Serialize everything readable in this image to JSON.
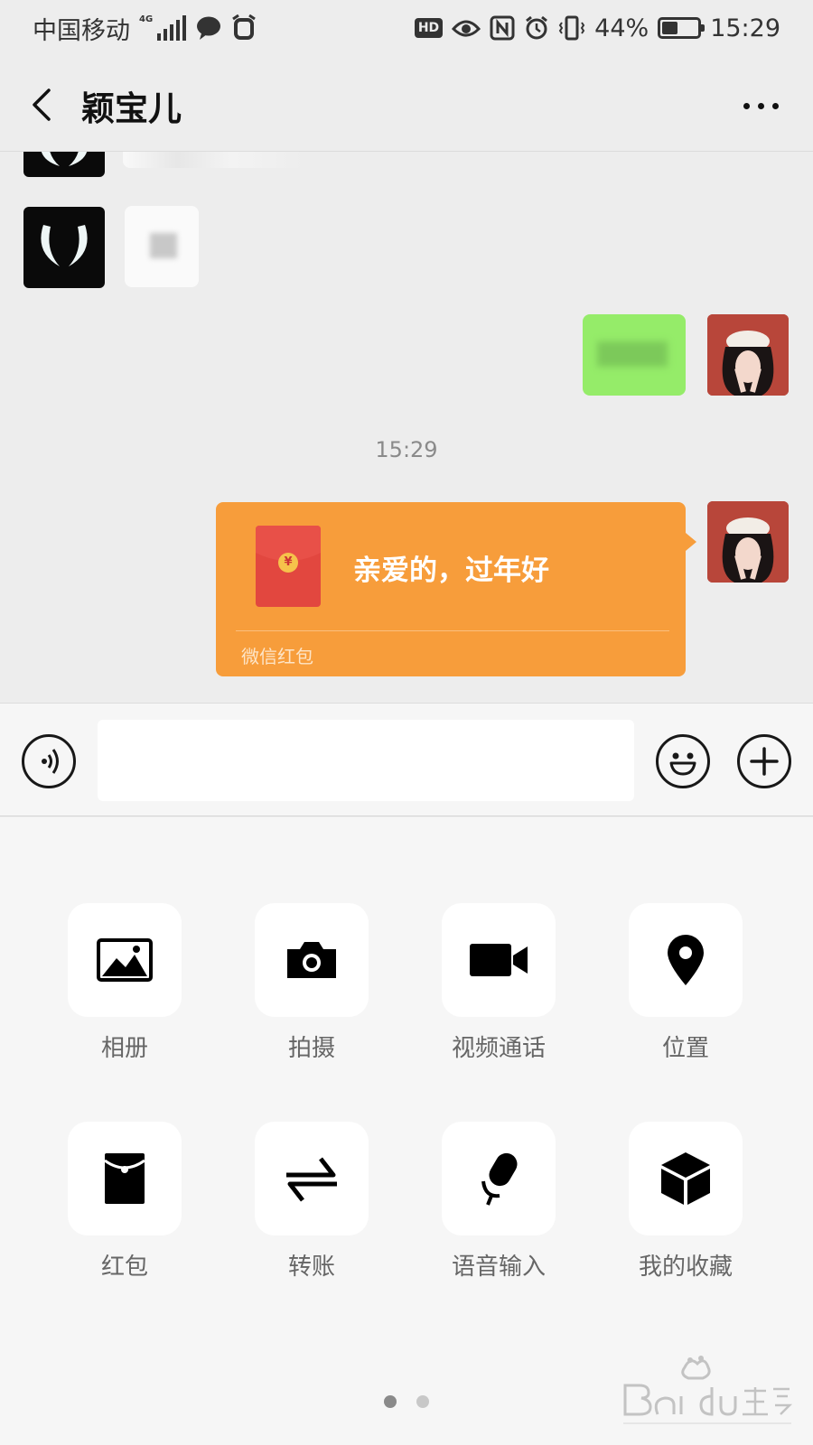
{
  "status_bar": {
    "carrier": "中国移动",
    "network": "4G",
    "hd": "HD",
    "battery_percent": "44%",
    "battery_level": 0.44,
    "time": "15:29"
  },
  "header": {
    "title": "颖宝儿"
  },
  "chat": {
    "timestamp": "15:29",
    "red_packet": {
      "message": "亲爱的，过年好",
      "footer": "微信红包",
      "coin_symbol": "¥"
    }
  },
  "input": {
    "value": "",
    "placeholder": ""
  },
  "panel": {
    "actions": [
      {
        "label": "相册",
        "icon": "album-icon"
      },
      {
        "label": "拍摄",
        "icon": "camera-icon"
      },
      {
        "label": "视频通话",
        "icon": "video-call-icon"
      },
      {
        "label": "位置",
        "icon": "location-icon"
      },
      {
        "label": "红包",
        "icon": "red-packet-icon"
      },
      {
        "label": "转账",
        "icon": "transfer-icon"
      },
      {
        "label": "语音输入",
        "icon": "microphone-icon"
      },
      {
        "label": "我的收藏",
        "icon": "favorites-icon"
      }
    ],
    "page_count": 2,
    "current_page": 1
  },
  "colors": {
    "bubble_green": "#95ec69",
    "red_packet_orange": "#f79d3b",
    "red_packet_red": "#e2473f"
  }
}
